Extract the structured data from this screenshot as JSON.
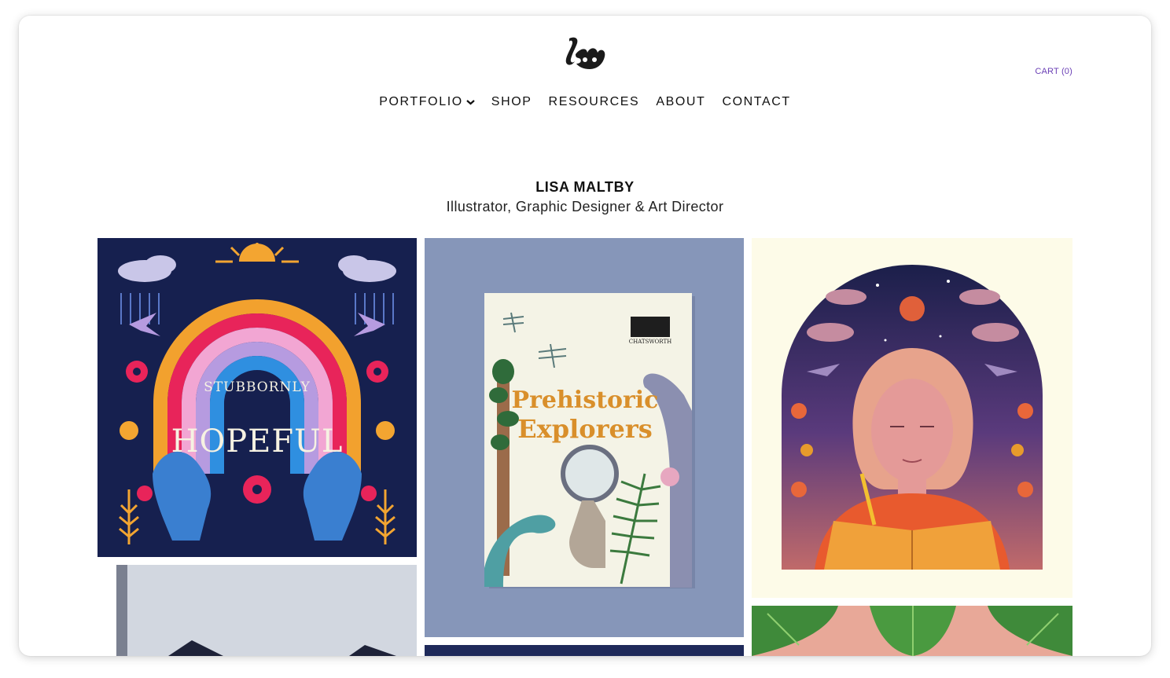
{
  "header": {
    "logo_text": "lm",
    "cart_label": "CART (0)"
  },
  "nav": {
    "items": [
      {
        "label": "PORTFOLIO",
        "has_dropdown": true
      },
      {
        "label": "SHOP"
      },
      {
        "label": "RESOURCES"
      },
      {
        "label": "ABOUT"
      },
      {
        "label": "CONTACT"
      }
    ]
  },
  "hero": {
    "name": "LISA MALTBY",
    "subtitle": "Illustrator, Graphic Designer & Art Director"
  },
  "gallery": {
    "tiles": [
      {
        "lettering": [
          "STUBBORNLY",
          "HOPEFUL"
        ],
        "icon": "rainbow-illustration"
      },
      {
        "lettering": [
          "Prehistoric",
          "Explorers",
          "CHATSWORTH"
        ],
        "icon": "book-cover-illustration"
      },
      {
        "icon": "reading-woman-illustration"
      },
      {
        "icon": "photo-partial"
      },
      {
        "icon": "navy-partial"
      },
      {
        "icon": "cabbage-partial"
      }
    ]
  },
  "colors": {
    "accent": "#6a3fb5",
    "text": "#111111",
    "navy": "#16204f",
    "slate": "#8696b9",
    "cream": "#fdfbe8"
  }
}
